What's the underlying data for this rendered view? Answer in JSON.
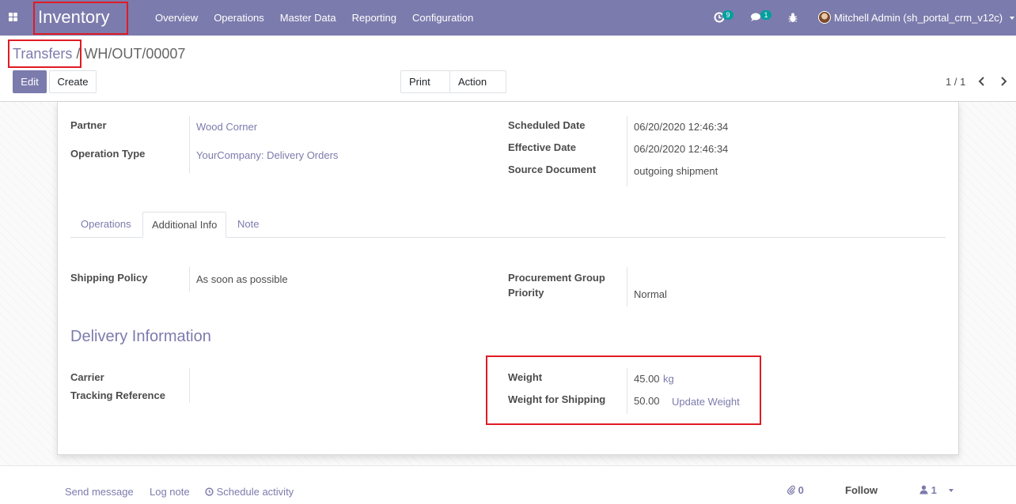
{
  "navbar": {
    "app_name": "Inventory",
    "menu": [
      "Overview",
      "Operations",
      "Master Data",
      "Reporting",
      "Configuration"
    ],
    "activity_count": "9",
    "message_count": "1",
    "user": "Mitchell Admin (sh_portal_crm_v12c)",
    "color": "#7c7bad"
  },
  "control_panel": {
    "breadcrumb_parent": "Transfers",
    "breadcrumb_sep": "/",
    "breadcrumb_current": "WH/OUT/00007",
    "edit_label": "Edit",
    "create_label": "Create",
    "print_label": "Print",
    "action_label": "Action",
    "pager": "1 / 1"
  },
  "form": {
    "partner_label": "Partner",
    "partner_value": "Wood Corner",
    "operation_type_label": "Operation Type",
    "operation_type_value": "YourCompany: Delivery Orders",
    "scheduled_date_label": "Scheduled Date",
    "scheduled_date_value": "06/20/2020 12:46:34",
    "effective_date_label": "Effective Date",
    "effective_date_value": "06/20/2020 12:46:34",
    "source_document_label": "Source Document",
    "source_document_value": "outgoing shipment"
  },
  "tabs": [
    "Operations",
    "Additional Info",
    "Note"
  ],
  "additional_info": {
    "shipping_policy_label": "Shipping Policy",
    "shipping_policy_value": "As soon as possible",
    "procurement_group_label": "Procurement Group",
    "priority_label": "Priority",
    "priority_value": "Normal"
  },
  "delivery": {
    "title": "Delivery Information",
    "carrier_label": "Carrier",
    "tracking_label": "Tracking Reference",
    "weight_label": "Weight",
    "weight_value": "45.00",
    "weight_unit": "kg",
    "weight_shipping_label": "Weight for Shipping",
    "weight_shipping_value": "50.00",
    "update_weight_label": "Update Weight"
  },
  "chatter": {
    "send_message": "Send message",
    "log_note": "Log note",
    "schedule_activity": "Schedule activity",
    "attachments_count": "0",
    "follow_label": "Follow",
    "followers_count": "1"
  }
}
